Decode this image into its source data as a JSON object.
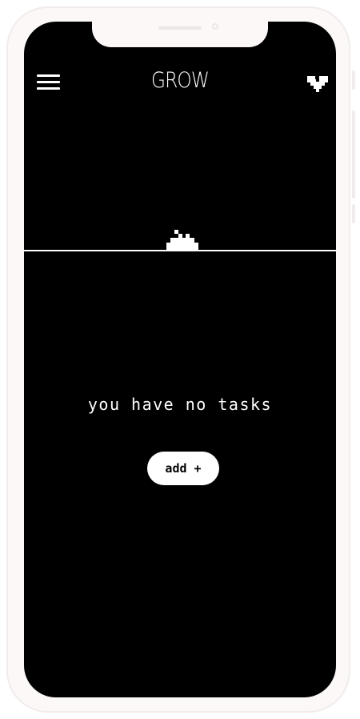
{
  "header": {
    "title": "GROW",
    "menu_icon": "hamburger-menu-icon",
    "favorite_icon": "pixel-heart-icon"
  },
  "scene": {
    "plant_icon": "pixel-sprout-icon"
  },
  "tasks": {
    "empty_message": "you have no tasks",
    "add_label": "add +"
  },
  "colors": {
    "background": "#000000",
    "foreground": "#ffffff",
    "frame": "#fcf8f7"
  }
}
